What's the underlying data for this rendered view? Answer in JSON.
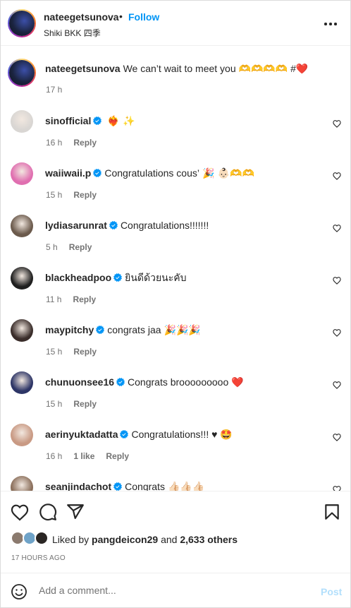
{
  "header": {
    "username": "nateegetsunova",
    "separator": "•",
    "follow_label": "Follow",
    "location": "Shiki BKK 四季",
    "more_icon": "more-horizontal-icon"
  },
  "caption": {
    "username": "nateegetsunova",
    "text": "We can’t wait to meet you 🫶🫶🫶🫶 #",
    "heart": "❤️",
    "time": "17 h"
  },
  "comments": [
    {
      "username": "sinofficial",
      "verified": true,
      "text": "",
      "emoji": "❤️‍🔥 ✨",
      "time": "16 h",
      "likes": "",
      "reply": "Reply",
      "avatar_color": "#d9d6d3"
    },
    {
      "username": "waiiwaii.p",
      "verified": true,
      "text": "Congratulations cous’",
      "emoji": "🎉 👶🏻🫶🫶",
      "time": "15 h",
      "likes": "",
      "reply": "Reply",
      "avatar_color": "#e06fb0"
    },
    {
      "username": "lydiasarunrat",
      "verified": true,
      "text": "Congratulations!!!!!!!",
      "emoji": "",
      "time": "5 h",
      "likes": "",
      "reply": "Reply",
      "avatar_color": "#6b5a4c"
    },
    {
      "username": "blackheadpoo",
      "verified": true,
      "text": "ยินดีด้วยนะคับ",
      "emoji": "",
      "time": "11 h",
      "likes": "",
      "reply": "Reply",
      "avatar_color": "#1f1f1f"
    },
    {
      "username": "maypitchy",
      "verified": true,
      "text": "congrats jaa",
      "emoji": "🎉🎉🎉",
      "time": "15 h",
      "likes": "",
      "reply": "Reply",
      "avatar_color": "#3a2d2a"
    },
    {
      "username": "chunuonsee16",
      "verified": true,
      "text": "Congrats brooooooooo",
      "emoji": "❤️",
      "time": "15 h",
      "likes": "",
      "reply": "Reply",
      "avatar_color": "#2d3566"
    },
    {
      "username": "aerinyuktadatta",
      "verified": true,
      "text": "Congratulations!!! ♥",
      "emoji": "🤩",
      "time": "16 h",
      "likes": "1 like",
      "reply": "Reply",
      "avatar_color": "#c99a84"
    },
    {
      "username": "seanjindachot",
      "verified": true,
      "text": "Congrats",
      "emoji": "👍🏻👍🏻👍🏻",
      "time": "",
      "likes": "",
      "reply": "",
      "avatar_color": "#8a6e5a"
    }
  ],
  "actions": {
    "like_icon": "heart-outline-icon",
    "comment_icon": "comment-icon",
    "share_icon": "paper-plane-icon",
    "save_icon": "bookmark-icon",
    "liked_by_prefix": "Liked by",
    "liked_by_user": "pangdeicon29",
    "liked_by_and": "and",
    "liked_by_count": "2,633 others",
    "post_time": "17 HOURS AGO"
  },
  "add_comment": {
    "emoji_icon": "smiley-icon",
    "placeholder": "Add a comment...",
    "post_label": "Post"
  },
  "colors": {
    "accent": "#0095f6",
    "post_disabled": "#b2dffc",
    "secondary_text": "#737373",
    "verified": "#0095f6",
    "heart_red": "#ed4956"
  }
}
